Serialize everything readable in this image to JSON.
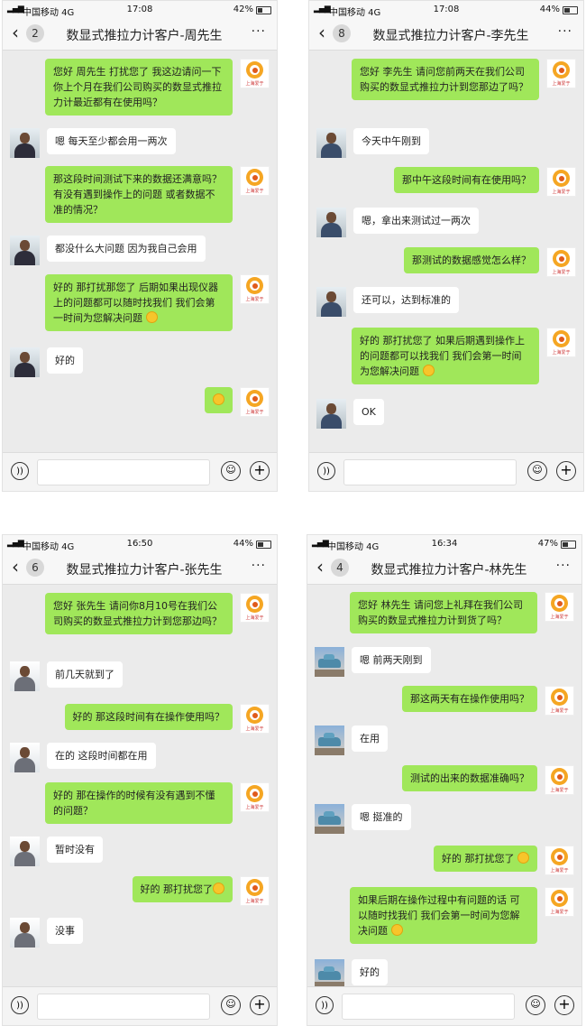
{
  "status_icons": {
    "signal": "signal-bars-icon",
    "battery": "battery-icon"
  },
  "screens": [
    {
      "status": {
        "carrier": "中国移动 4G",
        "time": "17:08",
        "battery": "42%",
        "battery_level": 0.42
      },
      "header": {
        "count": "2",
        "title": "数显式推拉力计客户-周先生"
      },
      "messages": [
        {
          "dir": "out",
          "text": "您好 周先生 打扰您了 我这边请问一下你上个月在我们公司购买的数显式推拉力计最近都有在使用吗？"
        },
        {
          "dir": "in",
          "text": "嗯 每天至少都会用一两次"
        },
        {
          "dir": "out",
          "text": "那这段时间测试下来的数据还满意吗？有没有遇到操作上的问题 或者数据不准的情况？"
        },
        {
          "dir": "in",
          "text": "都没什么大问题 因为我自己会用"
        },
        {
          "dir": "out",
          "text": "好的 那打扰那您了 后期如果出现仪器上的问题都可以随时找我们 我们会第一时间为您解决问题",
          "emoji": true
        },
        {
          "dir": "in",
          "text": "好的"
        },
        {
          "dir": "out",
          "text": "",
          "emoji": true
        }
      ]
    },
    {
      "status": {
        "carrier": "中国移动 4G",
        "time": "17:08",
        "battery": "44%",
        "battery_level": 0.44
      },
      "header": {
        "count": "8",
        "title": "数显式推拉力计客户-李先生"
      },
      "messages": [
        {
          "dir": "out",
          "text": "您好 李先生 请问您前两天在我们公司购买的数显式推拉力计到您那边了吗？"
        },
        {
          "dir": "in",
          "text": "今天中午刚到"
        },
        {
          "dir": "out",
          "text": "那中午这段时间有在使用吗？"
        },
        {
          "dir": "in",
          "text": "嗯，拿出来测试过一两次"
        },
        {
          "dir": "out",
          "text": "那测试的数据感觉怎么样？"
        },
        {
          "dir": "in",
          "text": "还可以，达到标准的"
        },
        {
          "dir": "out",
          "text": "好的 那打扰您了 如果后期遇到操作上的问题都可以找我们 我们会第一时间为您解决问题",
          "emoji": true
        },
        {
          "dir": "in",
          "text": "OK"
        }
      ]
    },
    {
      "status": {
        "carrier": "中国移动 4G",
        "time": "16:50",
        "battery": "44%",
        "battery_level": 0.44
      },
      "header": {
        "count": "6",
        "title": "数显式推拉力计客户-张先生"
      },
      "messages": [
        {
          "dir": "out",
          "text": "您好 张先生 请问你8月10号在我们公司购买的数显式推拉力计到您那边吗？"
        },
        {
          "dir": "in",
          "text": "前几天就到了"
        },
        {
          "dir": "out",
          "text": "好的 那这段时间有在操作使用吗？"
        },
        {
          "dir": "in",
          "text": "在的 这段时间都在用"
        },
        {
          "dir": "out",
          "text": "好的 那在操作的时候有没有遇到不懂的问题？"
        },
        {
          "dir": "in",
          "text": "暂时没有"
        },
        {
          "dir": "out",
          "text": "好的 那打扰您了",
          "emoji": true
        },
        {
          "dir": "in",
          "text": "没事"
        }
      ]
    },
    {
      "status": {
        "carrier": "中国移动 4G",
        "time": "16:34",
        "battery": "47%",
        "battery_level": 0.47
      },
      "header": {
        "count": "4",
        "title": "数显式推拉力计客户-林先生"
      },
      "messages": [
        {
          "dir": "out",
          "text": "您好 林先生 请问您上礼拜在我们公司购买的数显式推拉力计到货了吗？"
        },
        {
          "dir": "in",
          "text": "嗯 前两天刚到"
        },
        {
          "dir": "out",
          "text": "那这两天有在操作使用吗？"
        },
        {
          "dir": "in",
          "text": "在用"
        },
        {
          "dir": "out",
          "text": "测试的出来的数据准确吗？"
        },
        {
          "dir": "in",
          "text": "嗯 挺准的"
        },
        {
          "dir": "out",
          "text": "好的 那打扰您了",
          "emoji": true
        },
        {
          "dir": "out",
          "text": "如果后期在操作过程中有问题的话 可以随时找我们 我们会第一时间为您解决问题",
          "emoji": true
        },
        {
          "dir": "in",
          "text": "好的"
        }
      ]
    }
  ],
  "avatars": {
    "agent": "上海爱于",
    "customer_icons": [
      "person-icon",
      "person-icon",
      "person-icon",
      "car-icon"
    ]
  },
  "common": {
    "back_icon": "back-chevron-icon",
    "more_label": "···",
    "voice_icon": "voice-icon",
    "emoji_icon": "emoji-icon",
    "plus_icon": "plus-icon"
  }
}
